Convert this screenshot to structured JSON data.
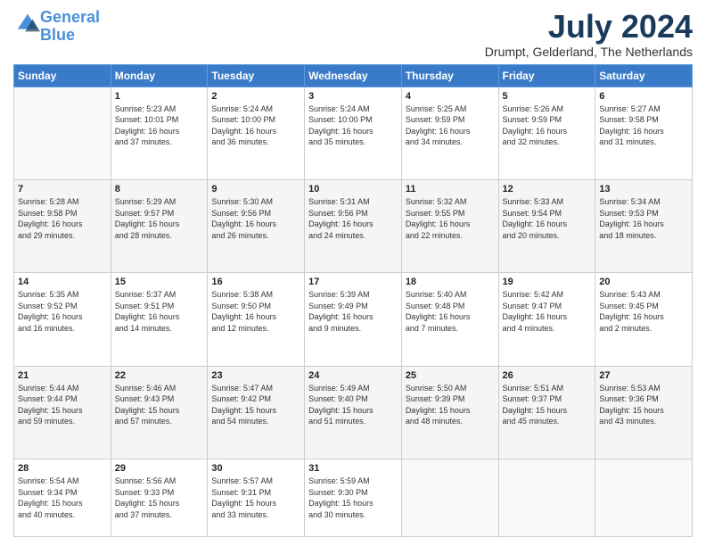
{
  "logo": {
    "line1": "General",
    "line2": "Blue"
  },
  "title": "July 2024",
  "subtitle": "Drumpt, Gelderland, The Netherlands",
  "headers": [
    "Sunday",
    "Monday",
    "Tuesday",
    "Wednesday",
    "Thursday",
    "Friday",
    "Saturday"
  ],
  "weeks": [
    [
      {
        "day": "",
        "info": ""
      },
      {
        "day": "1",
        "info": "Sunrise: 5:23 AM\nSunset: 10:01 PM\nDaylight: 16 hours\nand 37 minutes."
      },
      {
        "day": "2",
        "info": "Sunrise: 5:24 AM\nSunset: 10:00 PM\nDaylight: 16 hours\nand 36 minutes."
      },
      {
        "day": "3",
        "info": "Sunrise: 5:24 AM\nSunset: 10:00 PM\nDaylight: 16 hours\nand 35 minutes."
      },
      {
        "day": "4",
        "info": "Sunrise: 5:25 AM\nSunset: 9:59 PM\nDaylight: 16 hours\nand 34 minutes."
      },
      {
        "day": "5",
        "info": "Sunrise: 5:26 AM\nSunset: 9:59 PM\nDaylight: 16 hours\nand 32 minutes."
      },
      {
        "day": "6",
        "info": "Sunrise: 5:27 AM\nSunset: 9:58 PM\nDaylight: 16 hours\nand 31 minutes."
      }
    ],
    [
      {
        "day": "7",
        "info": "Sunrise: 5:28 AM\nSunset: 9:58 PM\nDaylight: 16 hours\nand 29 minutes."
      },
      {
        "day": "8",
        "info": "Sunrise: 5:29 AM\nSunset: 9:57 PM\nDaylight: 16 hours\nand 28 minutes."
      },
      {
        "day": "9",
        "info": "Sunrise: 5:30 AM\nSunset: 9:56 PM\nDaylight: 16 hours\nand 26 minutes."
      },
      {
        "day": "10",
        "info": "Sunrise: 5:31 AM\nSunset: 9:56 PM\nDaylight: 16 hours\nand 24 minutes."
      },
      {
        "day": "11",
        "info": "Sunrise: 5:32 AM\nSunset: 9:55 PM\nDaylight: 16 hours\nand 22 minutes."
      },
      {
        "day": "12",
        "info": "Sunrise: 5:33 AM\nSunset: 9:54 PM\nDaylight: 16 hours\nand 20 minutes."
      },
      {
        "day": "13",
        "info": "Sunrise: 5:34 AM\nSunset: 9:53 PM\nDaylight: 16 hours\nand 18 minutes."
      }
    ],
    [
      {
        "day": "14",
        "info": "Sunrise: 5:35 AM\nSunset: 9:52 PM\nDaylight: 16 hours\nand 16 minutes."
      },
      {
        "day": "15",
        "info": "Sunrise: 5:37 AM\nSunset: 9:51 PM\nDaylight: 16 hours\nand 14 minutes."
      },
      {
        "day": "16",
        "info": "Sunrise: 5:38 AM\nSunset: 9:50 PM\nDaylight: 16 hours\nand 12 minutes."
      },
      {
        "day": "17",
        "info": "Sunrise: 5:39 AM\nSunset: 9:49 PM\nDaylight: 16 hours\nand 9 minutes."
      },
      {
        "day": "18",
        "info": "Sunrise: 5:40 AM\nSunset: 9:48 PM\nDaylight: 16 hours\nand 7 minutes."
      },
      {
        "day": "19",
        "info": "Sunrise: 5:42 AM\nSunset: 9:47 PM\nDaylight: 16 hours\nand 4 minutes."
      },
      {
        "day": "20",
        "info": "Sunrise: 5:43 AM\nSunset: 9:45 PM\nDaylight: 16 hours\nand 2 minutes."
      }
    ],
    [
      {
        "day": "21",
        "info": "Sunrise: 5:44 AM\nSunset: 9:44 PM\nDaylight: 15 hours\nand 59 minutes."
      },
      {
        "day": "22",
        "info": "Sunrise: 5:46 AM\nSunset: 9:43 PM\nDaylight: 15 hours\nand 57 minutes."
      },
      {
        "day": "23",
        "info": "Sunrise: 5:47 AM\nSunset: 9:42 PM\nDaylight: 15 hours\nand 54 minutes."
      },
      {
        "day": "24",
        "info": "Sunrise: 5:49 AM\nSunset: 9:40 PM\nDaylight: 15 hours\nand 51 minutes."
      },
      {
        "day": "25",
        "info": "Sunrise: 5:50 AM\nSunset: 9:39 PM\nDaylight: 15 hours\nand 48 minutes."
      },
      {
        "day": "26",
        "info": "Sunrise: 5:51 AM\nSunset: 9:37 PM\nDaylight: 15 hours\nand 45 minutes."
      },
      {
        "day": "27",
        "info": "Sunrise: 5:53 AM\nSunset: 9:36 PM\nDaylight: 15 hours\nand 43 minutes."
      }
    ],
    [
      {
        "day": "28",
        "info": "Sunrise: 5:54 AM\nSunset: 9:34 PM\nDaylight: 15 hours\nand 40 minutes."
      },
      {
        "day": "29",
        "info": "Sunrise: 5:56 AM\nSunset: 9:33 PM\nDaylight: 15 hours\nand 37 minutes."
      },
      {
        "day": "30",
        "info": "Sunrise: 5:57 AM\nSunset: 9:31 PM\nDaylight: 15 hours\nand 33 minutes."
      },
      {
        "day": "31",
        "info": "Sunrise: 5:59 AM\nSunset: 9:30 PM\nDaylight: 15 hours\nand 30 minutes."
      },
      {
        "day": "",
        "info": ""
      },
      {
        "day": "",
        "info": ""
      },
      {
        "day": "",
        "info": ""
      }
    ]
  ]
}
